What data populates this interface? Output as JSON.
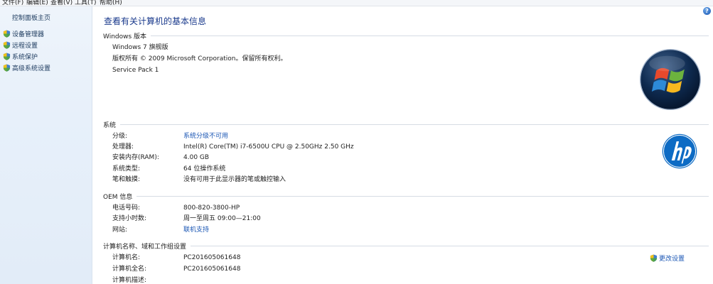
{
  "menu": [
    "文件(F)",
    "编辑(E)",
    "查看(V)",
    "工具(T)",
    "帮助(H)"
  ],
  "sidebar": {
    "home": "控制面板主页",
    "items": [
      {
        "label": "设备管理器"
      },
      {
        "label": "远程设置"
      },
      {
        "label": "系统保护"
      },
      {
        "label": "高级系统设置"
      }
    ]
  },
  "page": {
    "title": "查看有关计算机的基本信息",
    "help": "?"
  },
  "windows_edition": {
    "heading": "Windows 版本",
    "edition": "Windows 7 旗舰版",
    "copyright": "版权所有 © 2009 Microsoft Corporation。保留所有权利。",
    "service_pack": "Service Pack 1"
  },
  "system": {
    "heading": "系统",
    "rows": [
      {
        "label": "分级:",
        "value": "系统分级不可用"
      },
      {
        "label": "处理器:",
        "value": "Intel(R) Core(TM) i7-6500U CPU @ 2.50GHz   2.50 GHz"
      },
      {
        "label": "安装内存(RAM):",
        "value": "4.00 GB"
      },
      {
        "label": "系统类型:",
        "value": "64 位操作系统"
      },
      {
        "label": "笔和触摸:",
        "value": "没有可用于此显示器的笔或触控输入"
      }
    ]
  },
  "oem": {
    "heading": "OEM 信息",
    "rows": [
      {
        "label": "电话号码:",
        "value": "800-820-3800-HP"
      },
      {
        "label": "支持小时数:",
        "value": "周一至周五 09:00—21:00"
      },
      {
        "label": "网站:",
        "value": "联机支持"
      }
    ]
  },
  "computer": {
    "heading": "计算机名称、域和工作组设置",
    "change": "更改设置",
    "rows": [
      {
        "label": "计算机名:",
        "value": "PC201605061648"
      },
      {
        "label": "计算机全名:",
        "value": "PC201605061648"
      },
      {
        "label": "计算机描述:",
        "value": ""
      }
    ]
  },
  "colors": {
    "title": "#1a3a8c",
    "link": "#1a56b4",
    "sidebar_bg": "#e7f0fa"
  }
}
